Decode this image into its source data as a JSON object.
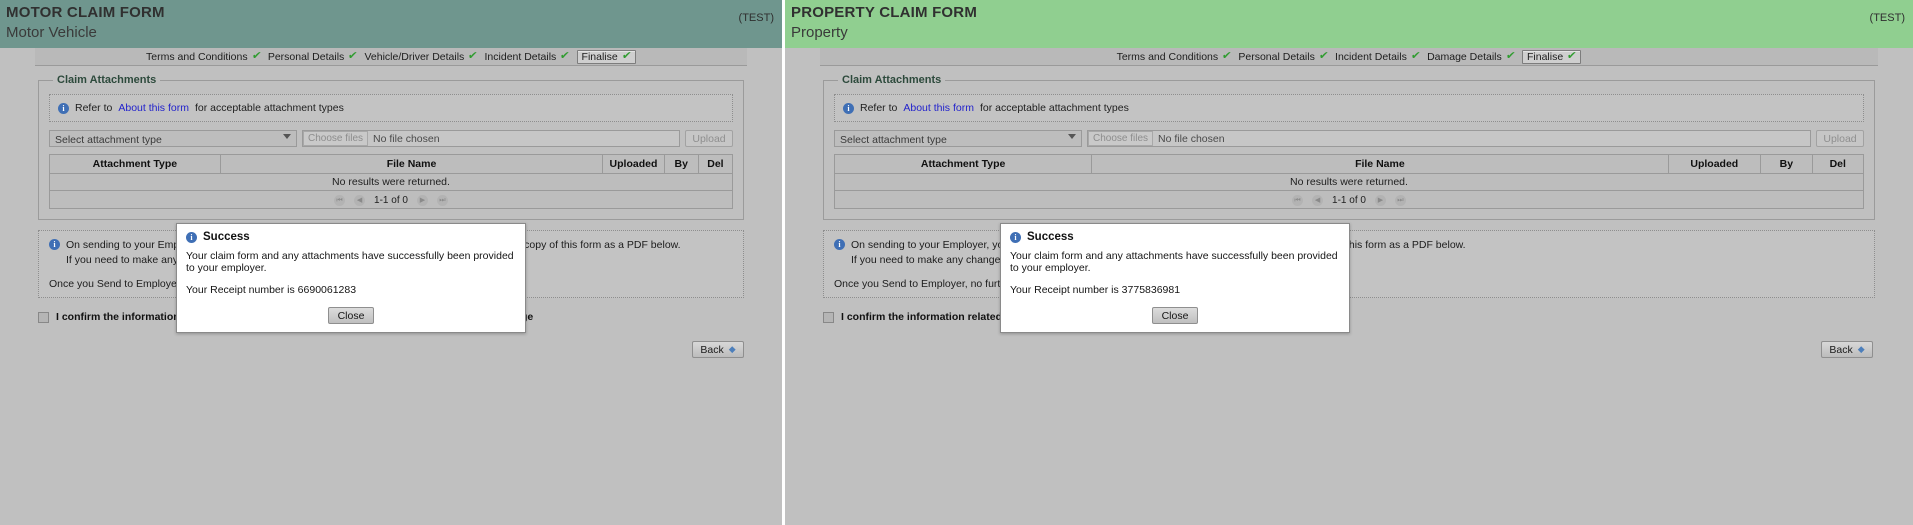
{
  "panes": [
    {
      "id": "motor",
      "header": {
        "title": "MOTOR CLAIM FORM",
        "subtitle": "Motor Vehicle",
        "test_tag": "(TEST)",
        "bg_color": "#6f968e"
      },
      "steps": [
        {
          "label": "Terms and Conditions",
          "tick": "✔",
          "current": false
        },
        {
          "label": "Personal Details",
          "tick": "✔",
          "current": false
        },
        {
          "label": "Vehicle/Driver Details",
          "tick": "✔",
          "current": false
        },
        {
          "label": "Incident Details",
          "tick": "✔",
          "current": false
        },
        {
          "label": "Finalise",
          "tick": "✔",
          "current": true
        }
      ],
      "attachments": {
        "legend": "Claim Attachments",
        "notice_prefix": "Refer to",
        "notice_link": "About this form",
        "notice_suffix": "for acceptable attachment types",
        "select_value": "Select attachment type",
        "choose_files_label": "Choose files",
        "no_file_text": "No file chosen",
        "upload_label": "Upload",
        "columns": [
          "Attachment Type",
          "File Name",
          "Uploaded",
          "By",
          "Del"
        ],
        "empty_text": "No results were returned.",
        "pager_text": "1-1 of 0"
      },
      "send_info": {
        "line1": "On sending to your Employer, you will be provided with a receipt number, and a link to download a copy of this form as a PDF below.",
        "line2": "If you need to make any changes, you may do so before you Send to Employer.",
        "line3": "Once you Send to Employer, no further changes can be made."
      },
      "confirm_label": "I confirm the information related to this incident is true and correct to the best of my knowledge",
      "back_label": "Back",
      "modal": {
        "title": "Success",
        "message": "Your claim form and any attachments have successfully been provided to your employer.",
        "receipt": "Your Receipt number is 6690061283",
        "close_label": "Close"
      }
    },
    {
      "id": "property",
      "header": {
        "title": "PROPERTY CLAIM FORM",
        "subtitle": "Property",
        "test_tag": "(TEST)",
        "bg_color": "#90cf90"
      },
      "steps": [
        {
          "label": "Terms and Conditions",
          "tick": "✔",
          "current": false
        },
        {
          "label": "Personal Details",
          "tick": "✔",
          "current": false
        },
        {
          "label": "Incident Details",
          "tick": "✔",
          "current": false
        },
        {
          "label": "Damage Details",
          "tick": "✔",
          "current": false
        },
        {
          "label": "Finalise",
          "tick": "✔",
          "current": true
        }
      ],
      "attachments": {
        "legend": "Claim Attachments",
        "notice_prefix": "Refer to",
        "notice_link": "About this form",
        "notice_suffix": "for acceptable attachment types",
        "select_value": "Select attachment type",
        "choose_files_label": "Choose files",
        "no_file_text": "No file chosen",
        "upload_label": "Upload",
        "columns": [
          "Attachment Type",
          "File Name",
          "Uploaded",
          "By",
          "Del"
        ],
        "empty_text": "No results were returned.",
        "pager_text": "1-1 of 0"
      },
      "send_info": {
        "line1": "On sending to your Employer, you will be provided with a receipt number, and a link to download a copy of this form as a PDF below.",
        "line2": "If you need to make any changes, you may do so before you Send to Employer.",
        "line3": "Once you Send to Employer, no further changes can be made."
      },
      "confirm_label": "I confirm the information related to this incident is true and correct to the best of my knowledge",
      "back_label": "Back",
      "modal": {
        "title": "Success",
        "message": "Your claim form and any attachments have successfully been provided to your employer.",
        "receipt": "Your Receipt number is 3775836981",
        "close_label": "Close"
      }
    }
  ],
  "icons": {
    "info": "i",
    "pager_first": "⏮",
    "pager_prev": "◀",
    "pager_next": "▶",
    "pager_last": "⏭",
    "back_arrow": "◆"
  }
}
